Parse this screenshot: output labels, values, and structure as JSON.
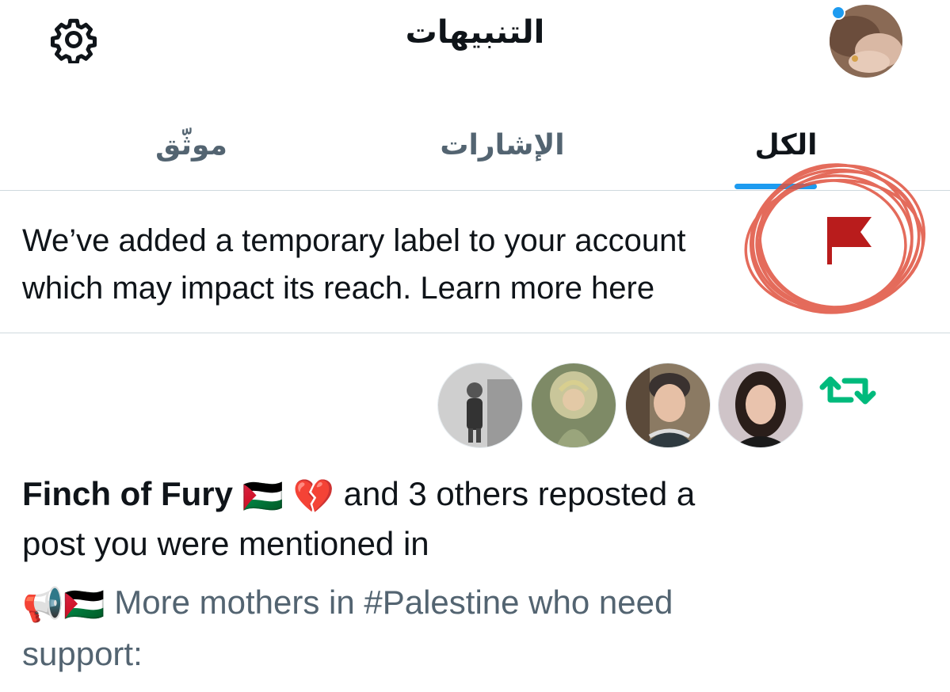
{
  "header": {
    "title": "التنبيهات",
    "icons": [
      "gear-icon",
      "avatar"
    ]
  },
  "tabs": [
    {
      "label": "الكل",
      "active": true
    },
    {
      "label": "الإشارات",
      "active": false
    },
    {
      "label": "موثّق",
      "active": false
    }
  ],
  "notice": {
    "line1": "We’ve added a temporary label to your account",
    "line2": "which may impact its reach. Learn more here",
    "icon": "flag-icon",
    "flag_color": "#b91c1c",
    "annotation_color": "#e0523f"
  },
  "repost_notification": {
    "icon": "repost-icon",
    "icon_color": "#00ba7c",
    "actor_name": "Finch of Fury",
    "actor_emoji": "🇵🇸 💔",
    "action_text": "and 3 others reposted a",
    "action_text_2": "post you were mentioned in",
    "post_emoji": "📢🇵🇸",
    "post_line1": "More mothers in #Palestine who need",
    "post_line2": "support:"
  },
  "colors": {
    "accent": "#1d9bf0",
    "text": "#0f1419",
    "secondary_text": "#536471",
    "divider": "#cfd9de"
  }
}
